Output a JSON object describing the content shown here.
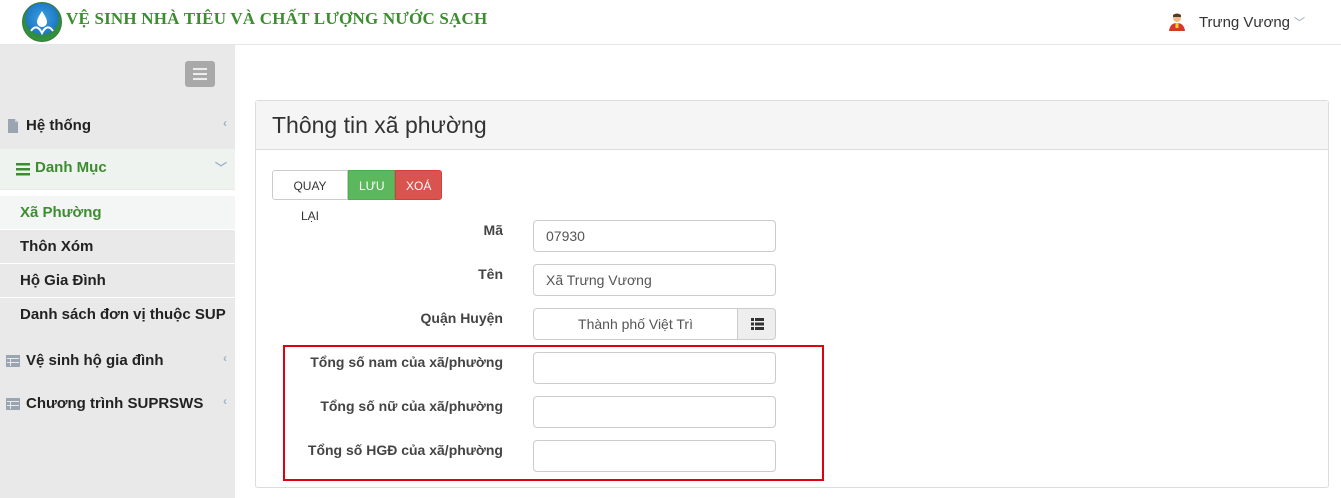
{
  "header": {
    "brand": "VỆ SINH NHÀ TIÊU VÀ CHẤT LƯỢNG NƯỚC SẠCH",
    "user_name": "Trưng Vương",
    "logo_icon": "sanitation-logo",
    "user_icon": "user-avatar-icon"
  },
  "sidebar": {
    "toggle_icon": "hamburger-icon",
    "items": [
      {
        "label": "Hệ thống",
        "icon": "file-icon"
      },
      {
        "label": "Danh Mục",
        "icon": "list-icon"
      },
      {
        "label": "Vệ sinh hộ gia đình",
        "icon": "table-icon"
      },
      {
        "label": "Chương trình SUPRSWS",
        "icon": "table-icon"
      }
    ],
    "sub_items": [
      {
        "label": "Xã Phường"
      },
      {
        "label": "Thôn Xóm"
      },
      {
        "label": "Hộ Gia Đình"
      },
      {
        "label": "Danh sách đơn vị thuộc SUP"
      }
    ]
  },
  "panel": {
    "title": "Thông tin xã phường",
    "buttons": {
      "back": "QUAY LẠI",
      "save": "LƯU",
      "delete": "XOÁ"
    },
    "fields": {
      "ma_label": "Mã",
      "ma_value": "07930",
      "ten_label": "Tên",
      "ten_value": "Xã Trưng Vương",
      "quan_label": "Quận Huyện",
      "quan_value": "Thành phố Việt Trì",
      "nam_label": "Tổng số nam của xã/phường",
      "nam_value": "",
      "nu_label": "Tổng số nữ của xã/phường",
      "nu_value": "",
      "hgd_label": "Tổng số HGĐ của xã/phường",
      "hgd_value": ""
    }
  },
  "colors": {
    "brand_green": "#3c8d2f",
    "save_green": "#5cb85c",
    "delete_red": "#d9534f",
    "highlight_red": "#e0000f"
  }
}
